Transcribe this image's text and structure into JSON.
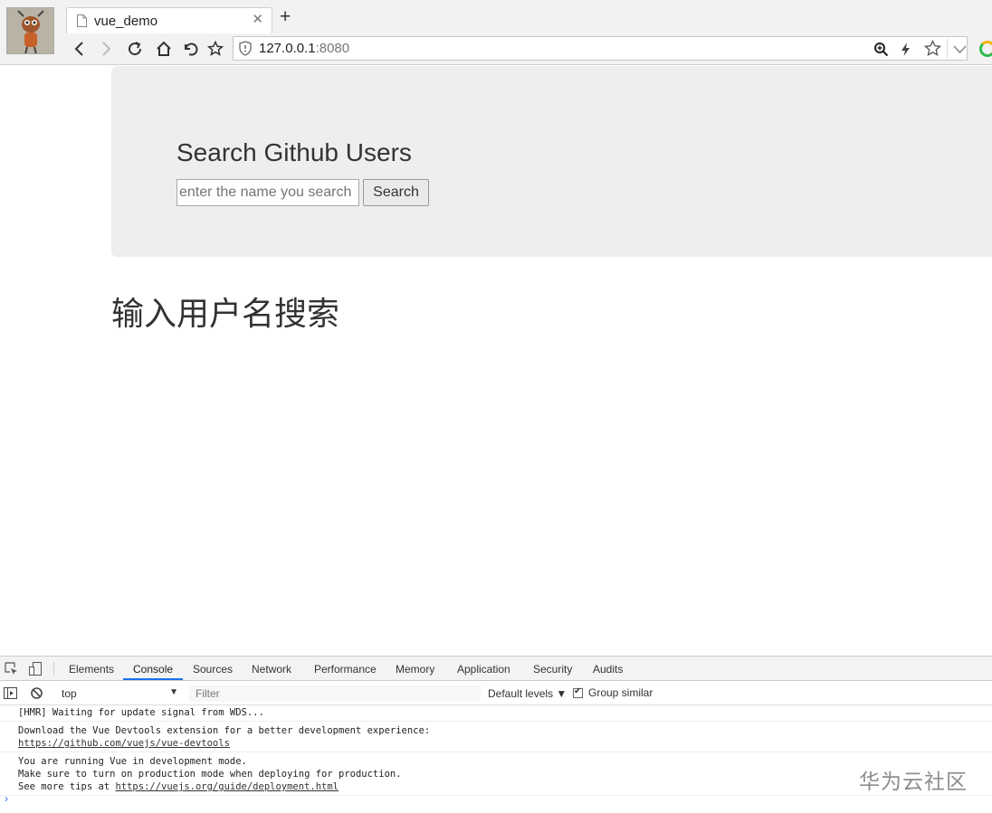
{
  "browser": {
    "tab_title": "vue_demo",
    "url_host": "127.0.0.1",
    "url_port": ":8080"
  },
  "page": {
    "heading": "Search Github Users",
    "search_placeholder": "enter the name you search",
    "search_button": "Search",
    "hint": "输入用户名搜索"
  },
  "devtools": {
    "tabs": [
      "Elements",
      "Console",
      "Sources",
      "Network",
      "Performance",
      "Memory",
      "Application",
      "Security",
      "Audits"
    ],
    "active_tab": "Console",
    "context": "top",
    "filter_placeholder": "Filter",
    "levels": "Default levels ▼",
    "group_similar": "Group similar",
    "messages": {
      "m1": "[HMR] Waiting for update signal from WDS...",
      "m2_line1": "Download the Vue Devtools extension for a better development experience:",
      "m2_link": "https://github.com/vuejs/vue-devtools",
      "m3_line1": "You are running Vue in development mode.",
      "m3_line2": "Make sure to turn on production mode when deploying for production.",
      "m3_prefix": "See more tips at ",
      "m3_link": "https://vuejs.org/guide/deployment.html"
    },
    "prompt": "›"
  },
  "watermark": "华为云社区",
  "colors": {
    "jumbotron_bg": "#eeeeee",
    "devtools_accent": "#1a73e8"
  }
}
